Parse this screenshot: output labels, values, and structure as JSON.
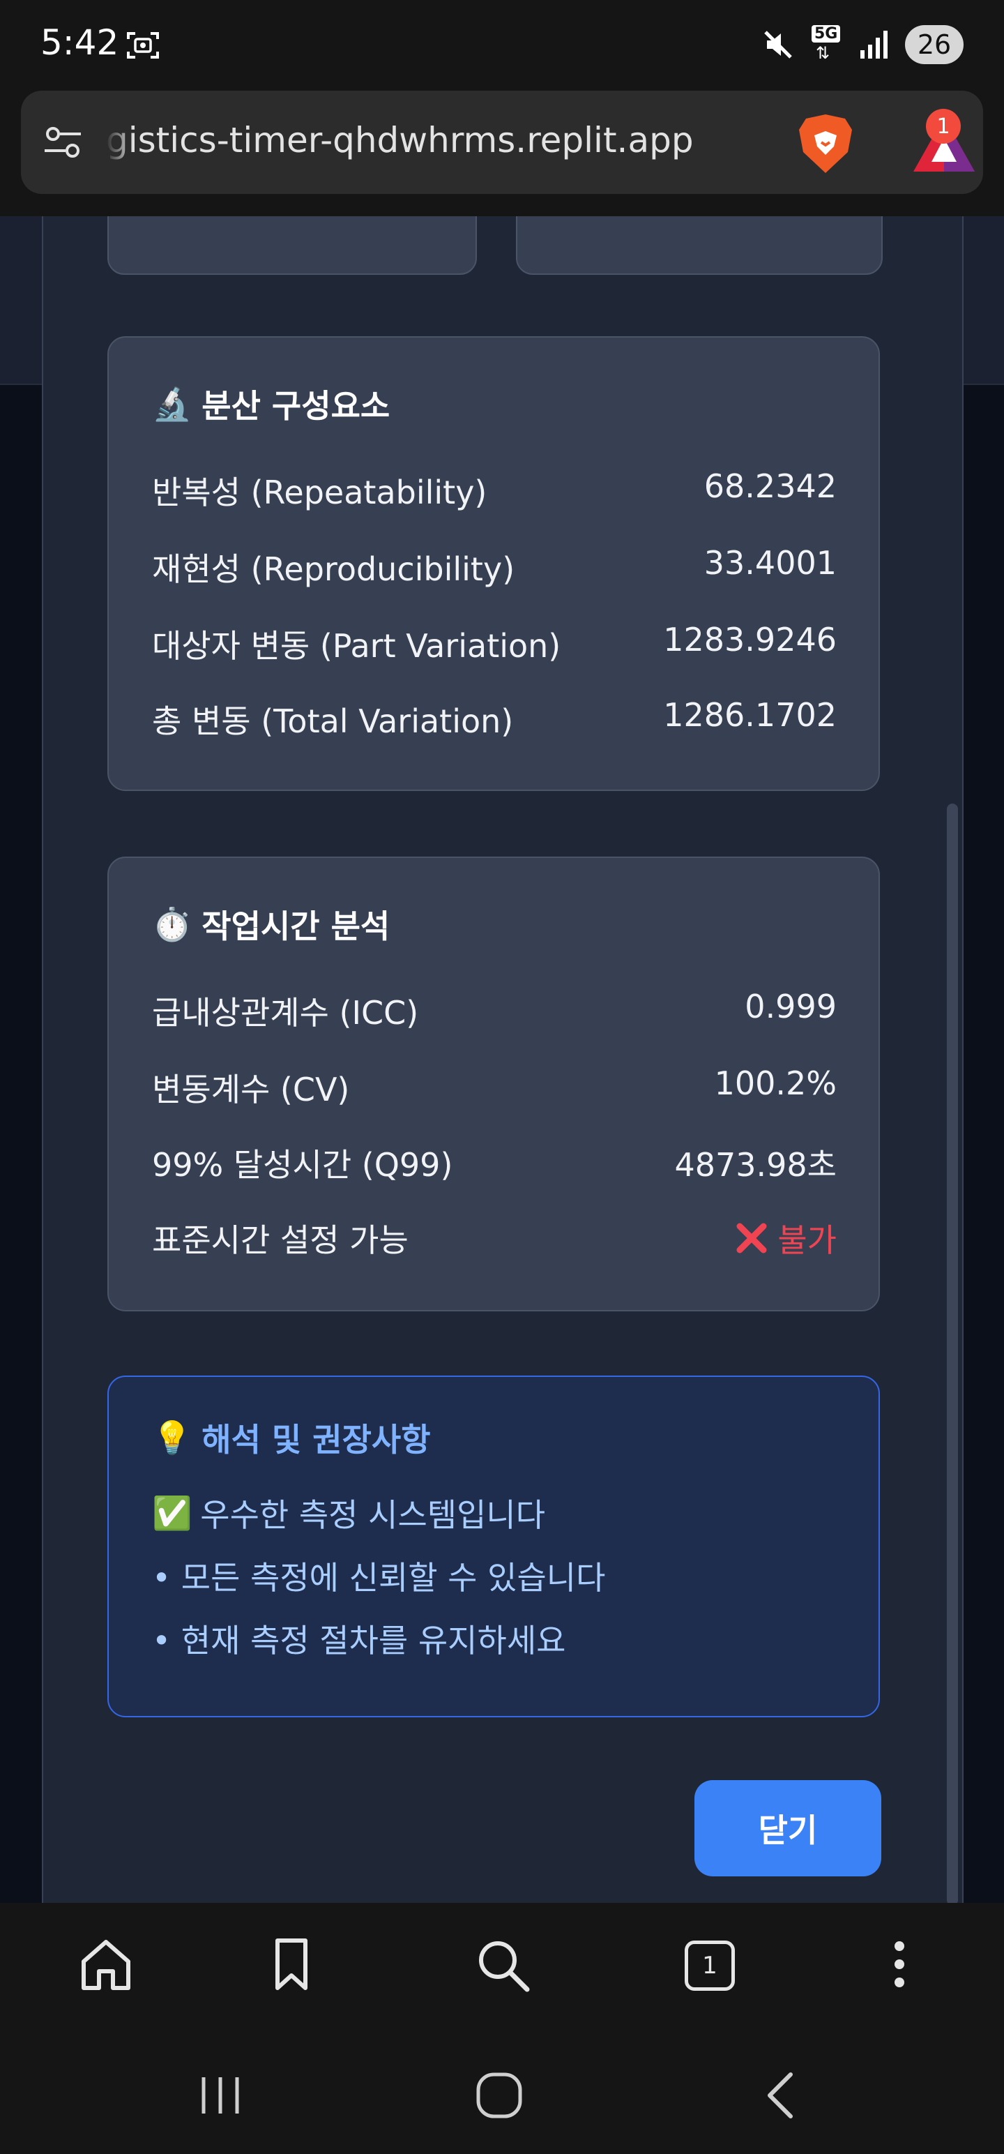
{
  "status_bar": {
    "time": "5:42",
    "network": "5G",
    "battery": "26"
  },
  "browser": {
    "url": "gistics-timer-qhdwhrms.replit.app",
    "rewards_badge": "1",
    "tab_count": "1"
  },
  "variance_card": {
    "icon": "microscope-icon",
    "emoji": "🔬",
    "title": "분산 구성요소",
    "rows": [
      {
        "label": "반복성 (Repeatability)",
        "value": "68.2342"
      },
      {
        "label": "재현성 (Reproducibility)",
        "value": "33.4001"
      },
      {
        "label": "대상자 변동 (Part Variation)",
        "value": "1283.9246"
      },
      {
        "label": "총 변동 (Total Variation)",
        "value": "1286.1702"
      }
    ]
  },
  "worktime_card": {
    "icon": "stopwatch-icon",
    "emoji": "⏱️",
    "title": "작업시간 분석",
    "rows": [
      {
        "label": "급내상관계수 (ICC)",
        "value": "0.999"
      },
      {
        "label": "변동계수 (CV)",
        "value": "100.2%"
      },
      {
        "label": "99% 달성시간 (Q99)",
        "value": "4873.98초"
      },
      {
        "label": "표준시간 설정 가능",
        "value": "불가",
        "status_icon": "cross-mark-icon",
        "status_color": "#f04452"
      }
    ]
  },
  "advice_card": {
    "icon": "lightbulb-icon",
    "emoji": "💡",
    "title": "해석 및 권장사항",
    "lines": [
      {
        "emoji": "✅",
        "text": "우수한 측정 시스템입니다"
      },
      {
        "text": "• 모든 측정에 신뢰할 수 있습니다"
      },
      {
        "text": "• 현재 측정 절차를 유지하세요"
      }
    ]
  },
  "close_button": {
    "label": "닫기"
  },
  "colors": {
    "modal_bg": "#1f2737",
    "card_bg": "#364052",
    "accent_blue": "#3b82f6",
    "advice_border": "#3466e6",
    "error_red": "#f04452"
  }
}
